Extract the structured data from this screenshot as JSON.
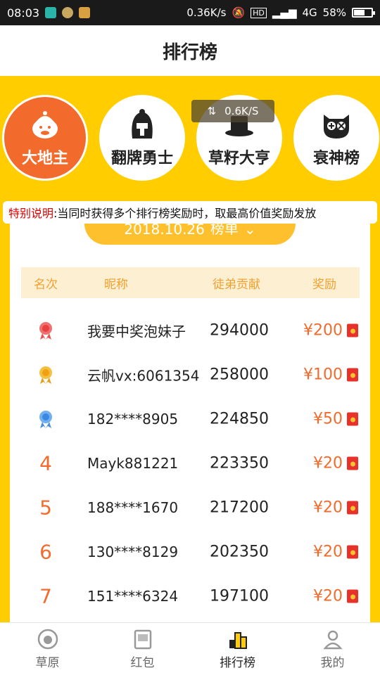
{
  "status_bar": {
    "time": "08:03",
    "speed": "0.36K/s",
    "network": "4G",
    "battery": "58%",
    "battery_level": 0.58
  },
  "header": {
    "title": "排行榜"
  },
  "categories": [
    {
      "label": "大地主",
      "icon": "landlord-icon",
      "active": true
    },
    {
      "label": "翻牌勇士",
      "icon": "warrior-icon",
      "active": false
    },
    {
      "label": "草籽大亨",
      "icon": "top-hat-icon",
      "active": false
    },
    {
      "label": "衰神榜",
      "icon": "owl-icon",
      "active": false
    }
  ],
  "speed_overlay": "0.6K/S",
  "notice": {
    "label": "特别说明",
    "text": ":当同时获得多个排行榜奖励时，取最高价值奖励发放"
  },
  "date_selector": {
    "date": "2018.10.26",
    "suffix": "榜单"
  },
  "table": {
    "headers": [
      "名次",
      "昵称",
      "徒弟贡献",
      "奖励"
    ],
    "rows": [
      {
        "rank": "1",
        "nickname": "我要中奖泡妹子",
        "contribution": "294000",
        "reward": "¥200"
      },
      {
        "rank": "2",
        "nickname": "云帆vx:6061354",
        "contribution": "258000",
        "reward": "¥100"
      },
      {
        "rank": "3",
        "nickname": "182****8905",
        "contribution": "224850",
        "reward": "¥50"
      },
      {
        "rank": "4",
        "nickname": "Mayk881221",
        "contribution": "223350",
        "reward": "¥20"
      },
      {
        "rank": "5",
        "nickname": "188****1670",
        "contribution": "217200",
        "reward": "¥20"
      },
      {
        "rank": "6",
        "nickname": "130****8129",
        "contribution": "202350",
        "reward": "¥20"
      },
      {
        "rank": "7",
        "nickname": "151****6324",
        "contribution": "197100",
        "reward": "¥20"
      }
    ]
  },
  "bottom_nav": [
    {
      "label": "草原",
      "icon": "meadow-icon",
      "active": false
    },
    {
      "label": "红包",
      "icon": "red-packet-icon",
      "active": false
    },
    {
      "label": "排行榜",
      "icon": "ranking-icon",
      "active": true
    },
    {
      "label": "我的",
      "icon": "profile-icon",
      "active": false
    }
  ],
  "colors": {
    "accent": "#ffcd00",
    "orange": "#f26b2c",
    "header_bg": "#fdf0d2"
  }
}
